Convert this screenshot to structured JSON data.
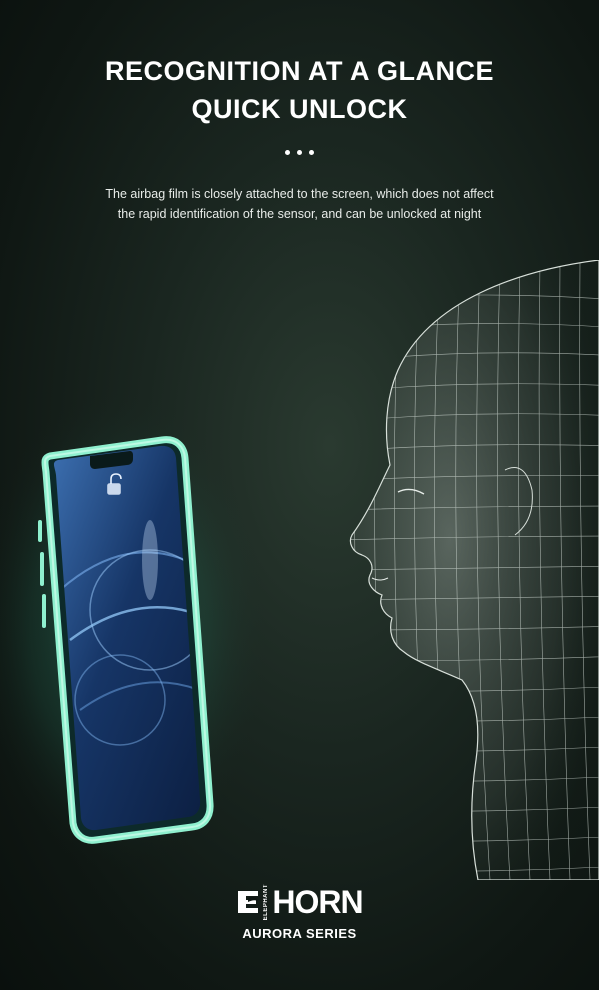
{
  "header": {
    "title_line1": "RECOGNITION AT A GLANCE",
    "title_line2": "QUICK UNLOCK"
  },
  "description": {
    "line1": "The airbag film is closely attached to the screen, which does not affect",
    "line2": "the rapid identification of the sensor, and can be unlocked at night"
  },
  "brand": {
    "small_text": "ELEPHANT",
    "word": "HORN",
    "series": "AURORA SERIES"
  },
  "colors": {
    "background": "#141e19",
    "glow": "#7fe8c4",
    "screen": "#1b3f7a",
    "mesh": "#cfd8d2"
  },
  "icons": {
    "phone": "phone-illustration",
    "face": "wireframe-face-illustration",
    "lock": "unlock-icon"
  }
}
